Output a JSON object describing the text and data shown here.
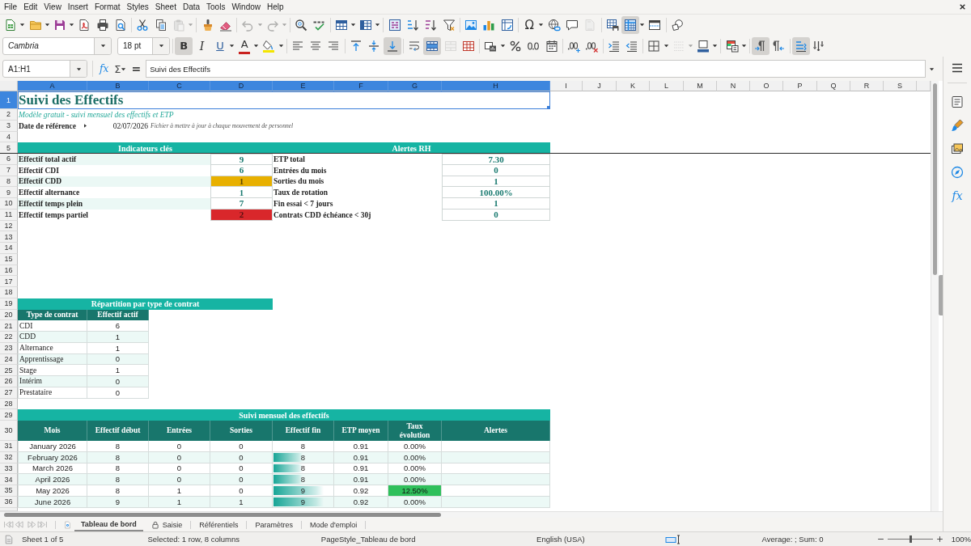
{
  "menu_bar": [
    "File",
    "Edit",
    "View",
    "Insert",
    "Format",
    "Styles",
    "Sheet",
    "Data",
    "Tools",
    "Window",
    "Help"
  ],
  "standard_toolbar": {
    "paste_disabled": true,
    "undo_disabled": true,
    "redo_disabled": true,
    "headers_footers_disabled": true,
    "special_character": "Ω",
    "freeze_rows_columns": true
  },
  "formatting_toolbar": {
    "font_name": "Cambria",
    "font_size": "18 pt",
    "bold_label": "B",
    "italic_label": "I",
    "underline_label": "U",
    "font_color_label": "A",
    "bold": true,
    "italic": false,
    "underline": false,
    "align_left": false,
    "align_center": false,
    "align_right": false,
    "align_top": false,
    "align_middle": false,
    "align_bottom": true,
    "wrap_text": false,
    "merge_and_center": true,
    "merge_cells_disabled": true,
    "border_style_disabled": true,
    "left_to_right": true,
    "right_to_left": false,
    "text_horizontal": true,
    "text_vertical": false
  },
  "formula_bar": {
    "name_box": "A1:H1",
    "function_wizard": "fx",
    "sum": "Σ",
    "formula": "=",
    "content": "Suivi des Effectifs"
  },
  "sidebar": {
    "functions": "fx"
  },
  "column_headers": [
    {
      "label": "A",
      "selected": true
    },
    {
      "label": "B",
      "selected": true
    },
    {
      "label": "C",
      "selected": true
    },
    {
      "label": "D",
      "selected": true
    },
    {
      "label": "E",
      "selected": true
    },
    {
      "label": "F",
      "selected": true
    },
    {
      "label": "G",
      "selected": true
    },
    {
      "label": "H",
      "selected": true
    },
    {
      "label": "I",
      "selected": false
    },
    {
      "label": "J",
      "selected": false
    },
    {
      "label": "K",
      "selected": false
    },
    {
      "label": "L",
      "selected": false
    },
    {
      "label": "M",
      "selected": false
    },
    {
      "label": "N",
      "selected": false
    },
    {
      "label": "O",
      "selected": false
    },
    {
      "label": "P",
      "selected": false
    },
    {
      "label": "Q",
      "selected": false
    },
    {
      "label": "R",
      "selected": false
    },
    {
      "label": "S",
      "selected": false
    }
  ],
  "row_headers": [
    {
      "label": "1",
      "selected": true
    },
    {
      "label": "2",
      "selected": false
    },
    {
      "label": "3",
      "selected": false
    },
    {
      "label": "4",
      "selected": false
    },
    {
      "label": "5",
      "selected": false
    },
    {
      "label": "6",
      "selected": false
    },
    {
      "label": "7",
      "selected": false
    },
    {
      "label": "8",
      "selected": false
    },
    {
      "label": "9",
      "selected": false
    },
    {
      "label": "10",
      "selected": false
    },
    {
      "label": "11",
      "selected": false
    },
    {
      "label": "12",
      "selected": false
    },
    {
      "label": "13",
      "selected": false
    },
    {
      "label": "14",
      "selected": false
    },
    {
      "label": "15",
      "selected": false
    },
    {
      "label": "16",
      "selected": false
    },
    {
      "label": "17",
      "selected": false
    },
    {
      "label": "18",
      "selected": false
    },
    {
      "label": "19",
      "selected": false
    },
    {
      "label": "20",
      "selected": false
    },
    {
      "label": "21",
      "selected": false
    },
    {
      "label": "22",
      "selected": false
    },
    {
      "label": "23",
      "selected": false
    },
    {
      "label": "24",
      "selected": false
    },
    {
      "label": "25",
      "selected": false
    },
    {
      "label": "26",
      "selected": false
    },
    {
      "label": "27",
      "selected": false
    },
    {
      "label": "28",
      "selected": false
    },
    {
      "label": "29",
      "selected": false
    },
    {
      "label": "30",
      "selected": false
    },
    {
      "label": "31",
      "selected": false
    },
    {
      "label": "32",
      "selected": false
    },
    {
      "label": "33",
      "selected": false
    },
    {
      "label": "34",
      "selected": false
    },
    {
      "label": "35",
      "selected": false
    },
    {
      "label": "36",
      "selected": false
    }
  ],
  "sheet": {
    "title": {
      "text": "Suivi des Effectifs",
      "selected": true
    },
    "subtitle": "Modèle gratuit - suivi mensuel des effectifs et ETP",
    "reference_label": {
      "text": "Date de référence",
      "clipped": true
    },
    "reference_date": "02/07/2026",
    "note": "Fichier à mettre à jour à chaque mouvement de personnel",
    "indicators": {
      "title": "Indicateurs clés",
      "items": [
        {
          "label": "Effectif total actif",
          "value": "9"
        },
        {
          "label": "Effectif CDI",
          "value": "6"
        },
        {
          "label": "Effectif CDD",
          "value": "1",
          "color": "#e8b000"
        },
        {
          "label": "Effectif alternance",
          "value": "1"
        },
        {
          "label": "Effectif temps plein",
          "value": "7"
        },
        {
          "label": "Effectif temps partiel",
          "value": "2",
          "color": "#d9272b"
        }
      ]
    },
    "alerts": {
      "title": "Alertes RH",
      "items": [
        {
          "label": "ETP total",
          "value": "7.30"
        },
        {
          "label": "Entrées du mois",
          "value": "0"
        },
        {
          "label": "Sorties du mois",
          "value": "1"
        },
        {
          "label": "Taux de rotation",
          "value": "100.00%"
        },
        {
          "label": "Fin essai < 7 jours",
          "value": "1"
        },
        {
          "label": "Contrats CDD échéance < 30j",
          "value": "0"
        }
      ]
    },
    "contracts": {
      "title": "Répartition par type de contrat",
      "columns": [
        "Type de contrat",
        "Effectif actif"
      ],
      "rows": [
        {
          "type": "CDI",
          "count": "6"
        },
        {
          "type": "CDD",
          "count": "1"
        },
        {
          "type": "Alternance",
          "count": "1"
        },
        {
          "type": "Apprentissage",
          "count": "0"
        },
        {
          "type": "Stage",
          "count": "1"
        },
        {
          "type": "Intérim",
          "count": "0"
        },
        {
          "type": "Prestataire",
          "count": "0"
        }
      ]
    },
    "monthly": {
      "title": "Suivi mensuel des effectifs",
      "columns": [
        "Mois",
        "Effectif début",
        "Entrées",
        "Sorties",
        "Effectif fin",
        "ETP moyen",
        "Taux évolution",
        "Alertes"
      ],
      "rows": [
        {
          "month": "January 2026",
          "start": "8",
          "entries": "0",
          "exits": "0",
          "end": "8",
          "etp": "0.91",
          "change": "0.00%"
        },
        {
          "month": "February 2026",
          "start": "8",
          "entries": "0",
          "exits": "0",
          "end": "8",
          "level": 0.48,
          "etp": "0.91",
          "change": "0.00%"
        },
        {
          "month": "March 2026",
          "start": "8",
          "entries": "0",
          "exits": "0",
          "end": "8",
          "level": 0.48,
          "etp": "0.91",
          "change": "0.00%"
        },
        {
          "month": "April 2026",
          "start": "8",
          "entries": "0",
          "exits": "0",
          "end": "8",
          "level": 0.48,
          "etp": "0.91",
          "change": "0.00%"
        },
        {
          "month": "May 2026",
          "start": "8",
          "entries": "1",
          "exits": "0",
          "end": "9",
          "level": 0.83,
          "etp": "0.92",
          "change": "12.50%",
          "color": "#2fc05b"
        },
        {
          "month": "June 2026",
          "start": "9",
          "entries": "1",
          "exits": "1",
          "end": "9",
          "level": 0.83,
          "etp": "0.92",
          "change": "0.00%"
        }
      ]
    }
  },
  "sheet_tabs": [
    {
      "label": "Tableau de bord",
      "selected": true,
      "protected": false
    },
    {
      "label": "Saisie",
      "selected": false,
      "protected": true
    },
    {
      "label": "Référentiels",
      "selected": false,
      "protected": false
    },
    {
      "label": "Paramètres",
      "selected": false,
      "protected": false
    },
    {
      "label": "Mode d'emploi",
      "selected": false,
      "protected": false
    }
  ],
  "status_bar": {
    "sheet": "Sheet 1 of 5",
    "selection": "Selected: 1 row, 8 columns",
    "page_style": "PageStyle_Tableau de bord",
    "language": "English (USA)",
    "summary": "Average: ; Sum: 0",
    "zoom_slider": {
      "level": 0.5
    },
    "zoom": "100%"
  }
}
